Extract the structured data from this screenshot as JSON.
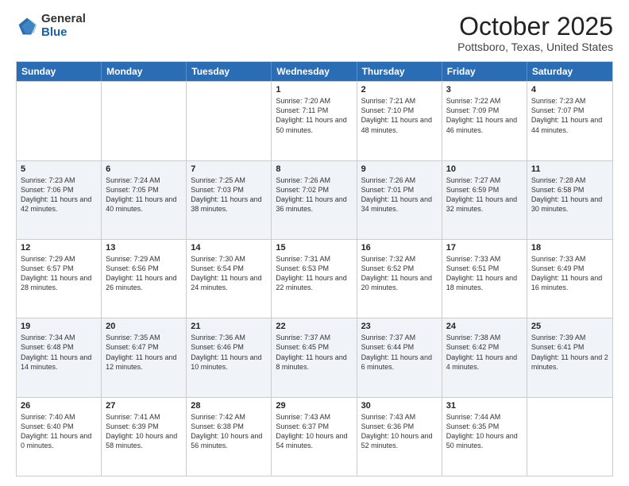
{
  "header": {
    "logo_general": "General",
    "logo_blue": "Blue",
    "title": "October 2025",
    "location": "Pottsboro, Texas, United States"
  },
  "weekdays": [
    "Sunday",
    "Monday",
    "Tuesday",
    "Wednesday",
    "Thursday",
    "Friday",
    "Saturday"
  ],
  "rows": [
    {
      "alt": false,
      "cells": [
        {
          "day": "",
          "sunrise": "",
          "sunset": "",
          "daylight": ""
        },
        {
          "day": "",
          "sunrise": "",
          "sunset": "",
          "daylight": ""
        },
        {
          "day": "",
          "sunrise": "",
          "sunset": "",
          "daylight": ""
        },
        {
          "day": "1",
          "sunrise": "Sunrise: 7:20 AM",
          "sunset": "Sunset: 7:11 PM",
          "daylight": "Daylight: 11 hours and 50 minutes."
        },
        {
          "day": "2",
          "sunrise": "Sunrise: 7:21 AM",
          "sunset": "Sunset: 7:10 PM",
          "daylight": "Daylight: 11 hours and 48 minutes."
        },
        {
          "day": "3",
          "sunrise": "Sunrise: 7:22 AM",
          "sunset": "Sunset: 7:09 PM",
          "daylight": "Daylight: 11 hours and 46 minutes."
        },
        {
          "day": "4",
          "sunrise": "Sunrise: 7:23 AM",
          "sunset": "Sunset: 7:07 PM",
          "daylight": "Daylight: 11 hours and 44 minutes."
        }
      ]
    },
    {
      "alt": true,
      "cells": [
        {
          "day": "5",
          "sunrise": "Sunrise: 7:23 AM",
          "sunset": "Sunset: 7:06 PM",
          "daylight": "Daylight: 11 hours and 42 minutes."
        },
        {
          "day": "6",
          "sunrise": "Sunrise: 7:24 AM",
          "sunset": "Sunset: 7:05 PM",
          "daylight": "Daylight: 11 hours and 40 minutes."
        },
        {
          "day": "7",
          "sunrise": "Sunrise: 7:25 AM",
          "sunset": "Sunset: 7:03 PM",
          "daylight": "Daylight: 11 hours and 38 minutes."
        },
        {
          "day": "8",
          "sunrise": "Sunrise: 7:26 AM",
          "sunset": "Sunset: 7:02 PM",
          "daylight": "Daylight: 11 hours and 36 minutes."
        },
        {
          "day": "9",
          "sunrise": "Sunrise: 7:26 AM",
          "sunset": "Sunset: 7:01 PM",
          "daylight": "Daylight: 11 hours and 34 minutes."
        },
        {
          "day": "10",
          "sunrise": "Sunrise: 7:27 AM",
          "sunset": "Sunset: 6:59 PM",
          "daylight": "Daylight: 11 hours and 32 minutes."
        },
        {
          "day": "11",
          "sunrise": "Sunrise: 7:28 AM",
          "sunset": "Sunset: 6:58 PM",
          "daylight": "Daylight: 11 hours and 30 minutes."
        }
      ]
    },
    {
      "alt": false,
      "cells": [
        {
          "day": "12",
          "sunrise": "Sunrise: 7:29 AM",
          "sunset": "Sunset: 6:57 PM",
          "daylight": "Daylight: 11 hours and 28 minutes."
        },
        {
          "day": "13",
          "sunrise": "Sunrise: 7:29 AM",
          "sunset": "Sunset: 6:56 PM",
          "daylight": "Daylight: 11 hours and 26 minutes."
        },
        {
          "day": "14",
          "sunrise": "Sunrise: 7:30 AM",
          "sunset": "Sunset: 6:54 PM",
          "daylight": "Daylight: 11 hours and 24 minutes."
        },
        {
          "day": "15",
          "sunrise": "Sunrise: 7:31 AM",
          "sunset": "Sunset: 6:53 PM",
          "daylight": "Daylight: 11 hours and 22 minutes."
        },
        {
          "day": "16",
          "sunrise": "Sunrise: 7:32 AM",
          "sunset": "Sunset: 6:52 PM",
          "daylight": "Daylight: 11 hours and 20 minutes."
        },
        {
          "day": "17",
          "sunrise": "Sunrise: 7:33 AM",
          "sunset": "Sunset: 6:51 PM",
          "daylight": "Daylight: 11 hours and 18 minutes."
        },
        {
          "day": "18",
          "sunrise": "Sunrise: 7:33 AM",
          "sunset": "Sunset: 6:49 PM",
          "daylight": "Daylight: 11 hours and 16 minutes."
        }
      ]
    },
    {
      "alt": true,
      "cells": [
        {
          "day": "19",
          "sunrise": "Sunrise: 7:34 AM",
          "sunset": "Sunset: 6:48 PM",
          "daylight": "Daylight: 11 hours and 14 minutes."
        },
        {
          "day": "20",
          "sunrise": "Sunrise: 7:35 AM",
          "sunset": "Sunset: 6:47 PM",
          "daylight": "Daylight: 11 hours and 12 minutes."
        },
        {
          "day": "21",
          "sunrise": "Sunrise: 7:36 AM",
          "sunset": "Sunset: 6:46 PM",
          "daylight": "Daylight: 11 hours and 10 minutes."
        },
        {
          "day": "22",
          "sunrise": "Sunrise: 7:37 AM",
          "sunset": "Sunset: 6:45 PM",
          "daylight": "Daylight: 11 hours and 8 minutes."
        },
        {
          "day": "23",
          "sunrise": "Sunrise: 7:37 AM",
          "sunset": "Sunset: 6:44 PM",
          "daylight": "Daylight: 11 hours and 6 minutes."
        },
        {
          "day": "24",
          "sunrise": "Sunrise: 7:38 AM",
          "sunset": "Sunset: 6:42 PM",
          "daylight": "Daylight: 11 hours and 4 minutes."
        },
        {
          "day": "25",
          "sunrise": "Sunrise: 7:39 AM",
          "sunset": "Sunset: 6:41 PM",
          "daylight": "Daylight: 11 hours and 2 minutes."
        }
      ]
    },
    {
      "alt": false,
      "cells": [
        {
          "day": "26",
          "sunrise": "Sunrise: 7:40 AM",
          "sunset": "Sunset: 6:40 PM",
          "daylight": "Daylight: 11 hours and 0 minutes."
        },
        {
          "day": "27",
          "sunrise": "Sunrise: 7:41 AM",
          "sunset": "Sunset: 6:39 PM",
          "daylight": "Daylight: 10 hours and 58 minutes."
        },
        {
          "day": "28",
          "sunrise": "Sunrise: 7:42 AM",
          "sunset": "Sunset: 6:38 PM",
          "daylight": "Daylight: 10 hours and 56 minutes."
        },
        {
          "day": "29",
          "sunrise": "Sunrise: 7:43 AM",
          "sunset": "Sunset: 6:37 PM",
          "daylight": "Daylight: 10 hours and 54 minutes."
        },
        {
          "day": "30",
          "sunrise": "Sunrise: 7:43 AM",
          "sunset": "Sunset: 6:36 PM",
          "daylight": "Daylight: 10 hours and 52 minutes."
        },
        {
          "day": "31",
          "sunrise": "Sunrise: 7:44 AM",
          "sunset": "Sunset: 6:35 PM",
          "daylight": "Daylight: 10 hours and 50 minutes."
        },
        {
          "day": "",
          "sunrise": "",
          "sunset": "",
          "daylight": ""
        }
      ]
    }
  ]
}
